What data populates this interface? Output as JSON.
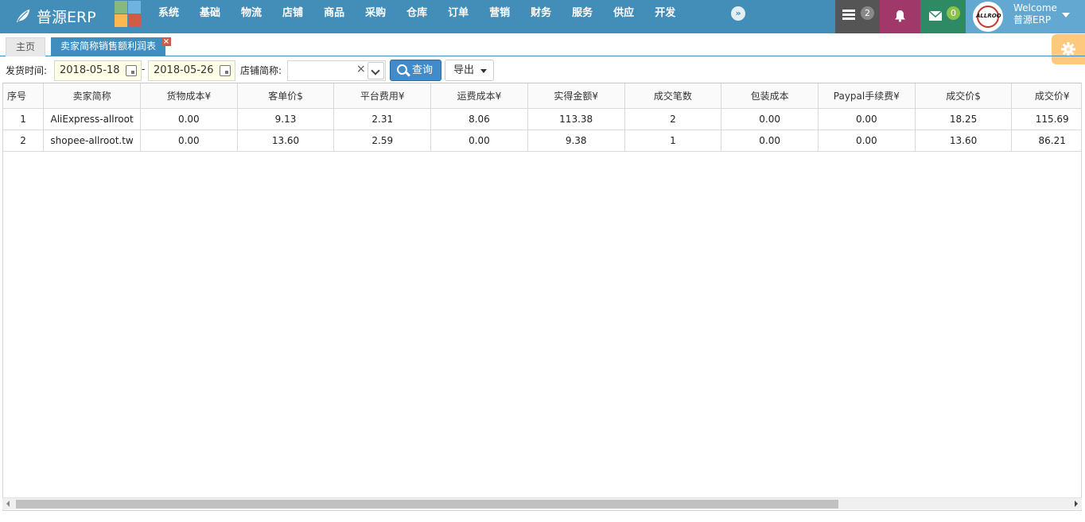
{
  "app": {
    "brand": "普源ERP"
  },
  "nav": {
    "menu": [
      "系统",
      "基础",
      "物流",
      "店铺",
      "商品",
      "采购",
      "仓库",
      "订单",
      "营销",
      "财务",
      "服务",
      "供应",
      "开发"
    ],
    "more_icon": "double-chevron-right-icon",
    "tasks_count": "2",
    "mail_count": "0",
    "welcome": "Welcome",
    "user_name": "普源ERP",
    "avatar_text": "ALLROOT",
    "colors": {
      "navbar": "#438eb9",
      "tasks": "#555555",
      "notice": "#a0396a",
      "mail": "#2e8965",
      "user": "#62a8d1"
    }
  },
  "tabs": [
    {
      "label": "主页",
      "active": false
    },
    {
      "label": "卖家简称销售额利润表",
      "active": true
    }
  ],
  "tab_close": "×",
  "toolbar": {
    "ship_time_label": "发货时间:",
    "date_from": "2018-05-18",
    "date_sep": "-",
    "date_to": "2018-05-26",
    "store_label": "店铺简称:",
    "store_value": "",
    "clear_glyph": "×",
    "query_label": "查询",
    "export_label": "导出"
  },
  "table": {
    "columns": [
      "序号",
      "卖家简称",
      "货物成本¥",
      "客单价$",
      "平台费用¥",
      "运费成本¥",
      "实得金额¥",
      "成交笔数",
      "包装成本",
      "Paypal手续费¥",
      "成交价$",
      "成交价¥"
    ],
    "rows": [
      [
        "1",
        "AliExpress-allroot",
        "0.00",
        "9.13",
        "2.31",
        "8.06",
        "113.38",
        "2",
        "0.00",
        "0.00",
        "18.25",
        "115.69"
      ],
      [
        "2",
        "shopee-allroot.tw",
        "0.00",
        "13.60",
        "2.59",
        "0.00",
        "9.38",
        "1",
        "0.00",
        "0.00",
        "13.60",
        "86.21"
      ]
    ]
  },
  "scrollbar": {
    "horizontal_position": 0
  }
}
